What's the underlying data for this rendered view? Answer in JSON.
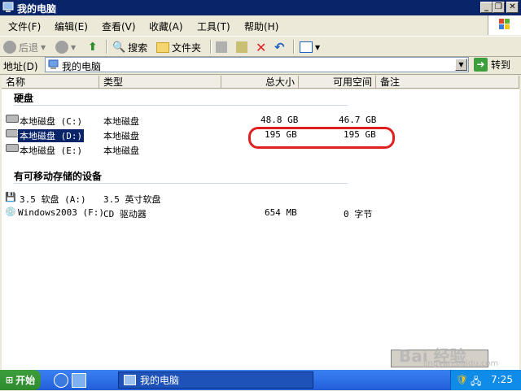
{
  "window": {
    "title": "我的电脑",
    "controls": {
      "minimize": "_",
      "restore": "❐",
      "close": "✕"
    }
  },
  "menubar": {
    "items": [
      "文件(F)",
      "编辑(E)",
      "查看(V)",
      "收藏(A)",
      "工具(T)",
      "帮助(H)"
    ]
  },
  "toolbar": {
    "back_label": "后退",
    "search_label": "搜索",
    "folders_label": "文件夹"
  },
  "address": {
    "label": "地址(D)",
    "value": "我的电脑",
    "go_label": "转到"
  },
  "columns": [
    "名称",
    "类型",
    "总大小",
    "可用空间",
    "备注"
  ],
  "groups": {
    "hard_disks": "硬盘",
    "removable": "有可移动存储的设备"
  },
  "hard_disks": [
    {
      "name": "本地磁盘 (C:)",
      "type": "本地磁盘",
      "total": "48.8 GB",
      "free": "46.7 GB"
    },
    {
      "name": "本地磁盘 (D:)",
      "type": "本地磁盘",
      "total": "195 GB",
      "free": "195 GB"
    },
    {
      "name": "本地磁盘 (E:)",
      "type": "本地磁盘",
      "total": "",
      "free": ""
    }
  ],
  "removable": [
    {
      "name": "3.5 软盘 (A:)",
      "type": "3.5 英寸软盘",
      "total": "",
      "free": ""
    },
    {
      "name": "Windows2003 (F:)",
      "type": "CD 驱动器",
      "total": "654 MB",
      "free": "0 字节"
    }
  ],
  "taskbar": {
    "start_label": "开始",
    "task_label": "我的电脑",
    "time": "7:25"
  },
  "watermark": {
    "brand": "Bai  经验",
    "url": "jingyan.baidu.com"
  },
  "colors": {
    "title_bar": "#0A246A",
    "selection": "#0A246A",
    "highlight_circle": "#E02020",
    "taskbar": "#225ED8",
    "start": "#3C9E3C"
  }
}
